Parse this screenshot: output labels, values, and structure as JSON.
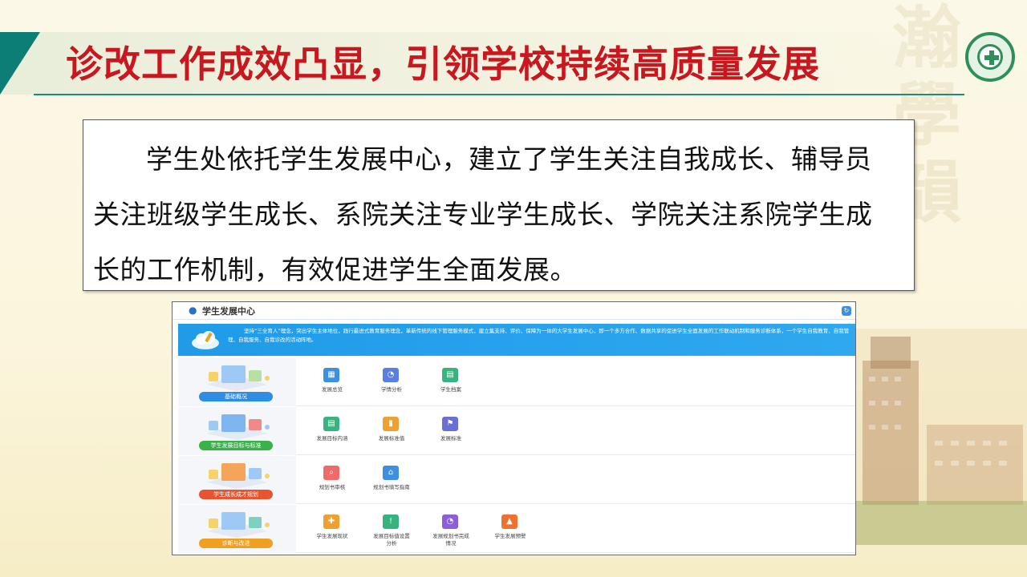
{
  "slide": {
    "title": "诊改工作成效凸显，引领学校持续高质量发展",
    "paragraph": "学生处依托学生发展中心，建立了学生关注自我成长、辅导员关注班级学生成长、系院关注专业学生成长、学院关注系院学生成长的工作机制，有效促进学生全面发展。"
  },
  "screenshot": {
    "header_title": "学生发展中心",
    "banner_text": "坚持“三全育人”理念，突出学生主体地位，践行最进式教育服务理念，革新传统的线下管理服务模式，建立集支持、评价、保障为一体的大学生发展中心，即一个多方合作、数据共享的促进学生全面发展的工作联动机制和服务诊断体系，一个学生自我教育、自我管理、自我服务、自我诊改的活动阵地。",
    "rows": [
      {
        "label": "基础概况",
        "pill_color": "#2f8de4",
        "items": [
          {
            "label": "发展总览",
            "icon": "grid-icon",
            "color": "#3d8fe0",
            "glyph": "▦"
          },
          {
            "label": "学情分析",
            "icon": "pie-chart-icon",
            "color": "#5b7fe0",
            "glyph": "◔"
          },
          {
            "label": "学生档案",
            "icon": "profile-card-icon",
            "color": "#36b37e",
            "glyph": "▤"
          }
        ]
      },
      {
        "label": "学生发展目标与标准",
        "pill_color": "#3ab24a",
        "items": [
          {
            "label": "发展目标内涵",
            "icon": "document-icon",
            "color": "#36b37e",
            "glyph": "▤"
          },
          {
            "label": "发展标准值",
            "icon": "bar-chart-icon",
            "color": "#f0a030",
            "glyph": "▮"
          },
          {
            "label": "发展标准",
            "icon": "flag-icon",
            "color": "#6a6fd8",
            "glyph": "⚑"
          }
        ]
      },
      {
        "label": "学生成长成才规划",
        "pill_color": "#e8542f",
        "items": [
          {
            "label": "规划书审核",
            "icon": "search-icon",
            "color": "#f06a6a",
            "glyph": "⌕"
          },
          {
            "label": "规划书填写指南",
            "icon": "graduation-cap-icon",
            "color": "#3d8fe0",
            "glyph": "⌂"
          }
        ]
      },
      {
        "label": "诊断与改进",
        "pill_color": "#f0a020",
        "items": [
          {
            "label": "学生发展现状",
            "icon": "puzzle-icon",
            "color": "#f0a030",
            "glyph": "✚"
          },
          {
            "label": "发展目标值设置分析",
            "icon": "alert-icon",
            "color": "#36b37e",
            "glyph": "!"
          },
          {
            "label": "发展规划书完成情况",
            "icon": "pie-chart-icon",
            "color": "#8a5fd8",
            "glyph": "◔"
          },
          {
            "label": "学生发展预警",
            "icon": "bell-icon",
            "color": "#f07030",
            "glyph": "▲"
          }
        ]
      }
    ]
  }
}
